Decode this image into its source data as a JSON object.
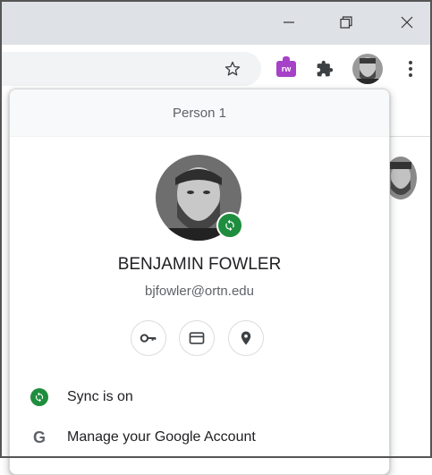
{
  "window": {
    "minimize_icon": "minimize-icon",
    "restore_icon": "restore-icon",
    "close_icon": "close-icon"
  },
  "toolbar": {
    "bookmark_icon": "star-icon",
    "extension_rw_label": "rw",
    "extensions_icon": "puzzle-icon",
    "profile_icon": "avatar",
    "menu_icon": "more-vert-icon"
  },
  "profile_popup": {
    "header": "Person 1",
    "name": "BENJAMIN FOWLER",
    "email": "bjfowler@ortn.edu",
    "shortcut_buttons": [
      "key-icon",
      "card-icon",
      "location-pin-icon"
    ],
    "items": [
      {
        "icon": "sync-icon",
        "label": "Sync is on"
      },
      {
        "icon": "google-g-icon",
        "label": "Manage your Google Account"
      }
    ]
  },
  "colors": {
    "titlebar": "#dee1e6",
    "sync_green": "#1e8e3e",
    "extension_purple": "#a542c7",
    "text_primary": "#202124",
    "text_secondary": "#5f6368"
  }
}
